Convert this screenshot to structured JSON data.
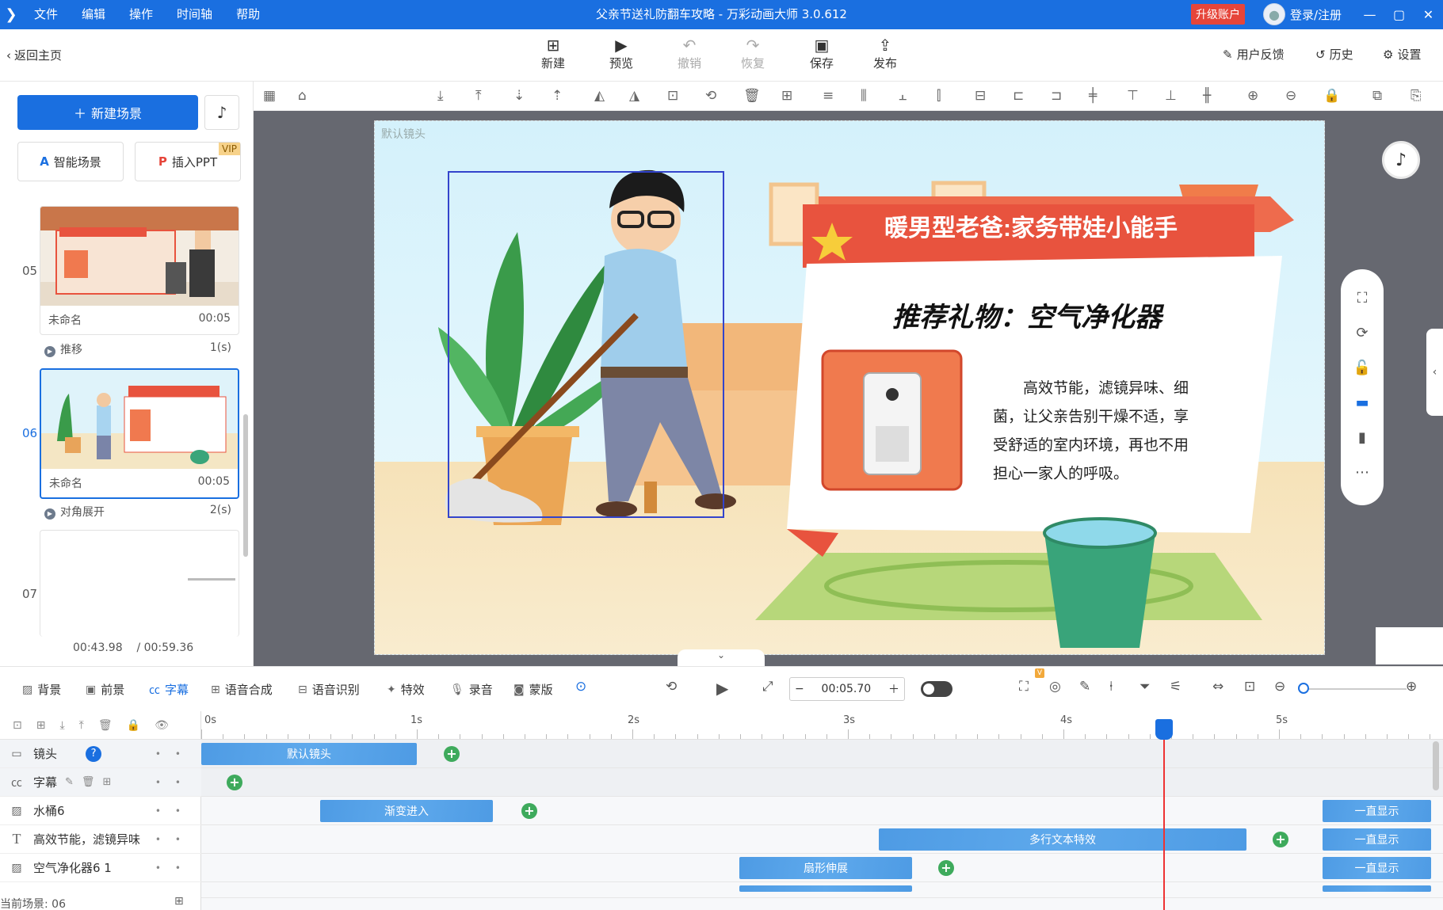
{
  "window": {
    "title": "父亲节送礼防翻车攻略 - 万彩动画大师 3.0.612",
    "menu": [
      "文件",
      "编辑",
      "操作",
      "时间轴",
      "帮助"
    ],
    "upgrade_label": "升级账户",
    "login_label": "登录/注册"
  },
  "toolbar": {
    "back_label": "返回主页",
    "new_label": "新建",
    "preview_label": "预览",
    "undo_label": "撤销",
    "redo_label": "恢复",
    "save_label": "保存",
    "publish_label": "发布",
    "feedback_label": "用户反馈",
    "history_label": "历史",
    "settings_label": "设置"
  },
  "left_panel": {
    "new_scene_label": "新建场景",
    "smart_scene_label": "智能场景",
    "insert_ppt_label": "插入PPT",
    "vip_label": "VIP",
    "scenes": [
      {
        "number": "05",
        "name": "未命名",
        "duration": "00:05",
        "transition": "推移",
        "transition_time": "1(s)"
      },
      {
        "number": "06",
        "name": "未命名",
        "duration": "00:05",
        "transition": "对角展开",
        "transition_time": "2(s)"
      },
      {
        "number": "07"
      }
    ],
    "current_time": "00:43.98",
    "total_time": "/ 00:59.36"
  },
  "canvas": {
    "camera_label": "默认镜头",
    "banner_title": "暖男型老爸:家务带娃小能手",
    "gift_title": "推荐礼物：空气净化器",
    "description": "高效节能，滤镜异味、细菌，让父亲告别干燥不适，享受舒适的室内环境，再也不用担心一家人的呼吸。"
  },
  "timeline_toolbar": {
    "tabs": [
      "背景",
      "前景",
      "字幕",
      "语音合成",
      "语音识别",
      "特效",
      "录音",
      "蒙版"
    ],
    "active_tab": "字幕",
    "time_value": "00:05.70",
    "vip_mark": "V"
  },
  "timeline": {
    "ruler_labels": [
      "0s",
      "1s",
      "2s",
      "3s",
      "4s",
      "5s"
    ],
    "layers": [
      {
        "name": "镜头",
        "icon": "camera-icon"
      },
      {
        "name": "字幕",
        "icon": "subtitle-icon"
      },
      {
        "name": "水桶6",
        "icon": "image-icon"
      },
      {
        "name": "高效节能，滤镜异味",
        "icon": "text-icon"
      },
      {
        "name": "空气净化器6 1",
        "icon": "image-icon"
      }
    ],
    "clips": {
      "camera": "默认镜头",
      "bucket": "渐变进入",
      "text": "多行文本特效",
      "purifier": "扇形伸展",
      "always_show": "一直显示"
    },
    "current_scene_label": "当前场景: 06"
  },
  "colors": {
    "accent": "#1a6fe0",
    "clip": "#4e9be4",
    "keyframe": "#3eaa5c",
    "playhead": "#e33333",
    "banner": "#e8533e"
  }
}
